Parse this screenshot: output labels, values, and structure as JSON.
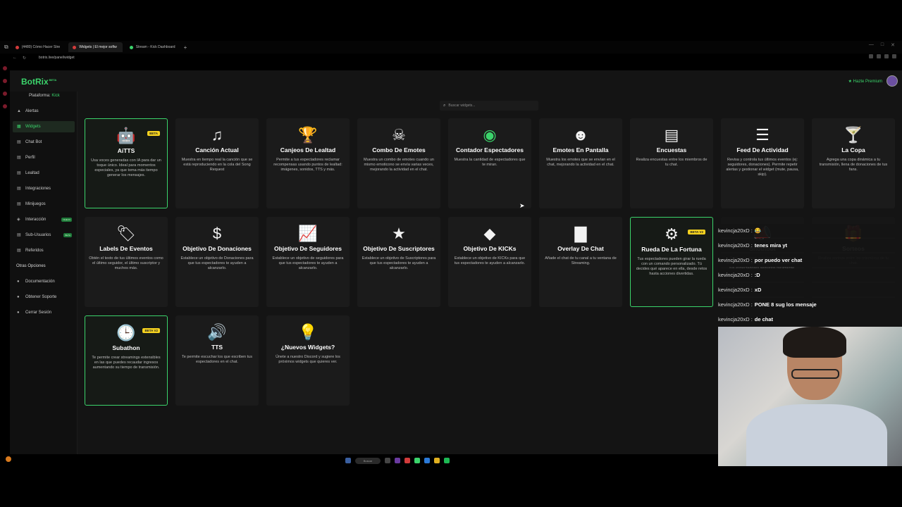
{
  "browser": {
    "tabs": [
      {
        "label": "(4480) Cómo Hacer Stre",
        "color": "#d23b3b",
        "active": false
      },
      {
        "label": "Widgets | El mejor softw",
        "color": "#d23b3b",
        "active": true
      },
      {
        "label": "Stream - Kick Dashboard",
        "color": "#3bd46b",
        "active": false
      }
    ],
    "url": "botrix.live/panel/widget"
  },
  "app": {
    "logo": "BotRix",
    "logo_badge": "BETA",
    "premium": "★ Hazte Premium",
    "platform_label": "Plataforma:",
    "platform_value": "Kick"
  },
  "sidebar": {
    "items": [
      {
        "label": "Alertas",
        "icon": "▲"
      },
      {
        "label": "Widgets",
        "icon": "▦"
      },
      {
        "label": "Chat Bot",
        "icon": "▤"
      },
      {
        "label": "Perfil",
        "icon": "▤"
      },
      {
        "label": "Lealtad",
        "icon": "▤"
      },
      {
        "label": "Integraciones",
        "icon": "▤"
      },
      {
        "label": "Minijuegos",
        "icon": "▤"
      },
      {
        "label": "Interacción",
        "icon": "◈",
        "badge": "NUEVO"
      },
      {
        "label": "Sub-Usuarios",
        "icon": "▤",
        "badge": "BETA"
      },
      {
        "label": "Referidos",
        "icon": "▤"
      }
    ],
    "other_title": "Otras Opciones",
    "other_items": [
      {
        "label": "Documentación",
        "icon": "●"
      },
      {
        "label": "Obtener Soporte",
        "icon": "●"
      },
      {
        "label": "Cerrar Sesión",
        "icon": "●"
      }
    ]
  },
  "search": {
    "placeholder": "Buscar widgets..."
  },
  "widgets": [
    {
      "title": "AiTTS",
      "desc": "Usa voces generadas con IA para dar un toque único. Ideal para momentos especiales, ya que toma más tiempo generar los mensajes.",
      "icon": "robot-icon",
      "glyph": "🤖",
      "badge": "BETA",
      "highlight": true
    },
    {
      "title": "Canción Actual",
      "desc": "Muestra en tiempo real la canción que se está reproduciendo en la cola del Song Request",
      "icon": "music-icon",
      "glyph": "♫"
    },
    {
      "title": "Canjeos De Lealtad",
      "desc": "Permite a tus espectadores reclamar recompensas usando puntos de lealtad: imágenes, sonidos, TTS y más.",
      "icon": "trophy-icon",
      "glyph": "🏆"
    },
    {
      "title": "Combo De Emotes",
      "desc": "Muestra un combo de emotes cuando un mismo emoticono se envía varias veces, mejorando la actividad en el chat.",
      "icon": "skull-icon",
      "glyph": "☠"
    },
    {
      "title": "Contador Espectadores",
      "desc": "Muestra la cantidad de espectadores que te miran.",
      "icon": "eye-icon",
      "glyph": "◉",
      "icon_color": "#3bd46b"
    },
    {
      "title": "Emotes En Pantalla",
      "desc": "Muestra los emotes que se envían en el chat, mejorando la actividad en el chat.",
      "icon": "grin-icon",
      "glyph": "☻"
    },
    {
      "title": "Encuestas",
      "desc": "Realiza encuestas entre los miembros de tu chat.",
      "icon": "poll-icon",
      "glyph": "▤"
    },
    {
      "title": "Feed De Actividad",
      "desc": "Revisa y controla tus últimos eventos (ej: seguidores, donaciones). Permite repetir alertas y gestionar el widget (mute, pausa, skip).",
      "icon": "list-icon",
      "glyph": "☰"
    },
    {
      "title": "La Copa",
      "desc": "Agrega una copa dinámica a tu transmisión, llena de donaciones de tus fans.",
      "icon": "cup-icon",
      "glyph": "🍸"
    },
    {
      "title": "Labels De Eventos",
      "desc": "Obtén el texto de tus últimos eventos como el último seguidor, el último suscriptor y muchos más.",
      "icon": "tag-icon",
      "glyph": "🏷"
    },
    {
      "title": "Objetivo De Donaciones",
      "desc": "Establece un objetivo de Donaciones para que tus espectadores te ayuden a alcanzarlo.",
      "icon": "dollar-icon",
      "glyph": "$"
    },
    {
      "title": "Objetivo De Seguidores",
      "desc": "Establece un objetivo de seguidores para que tus espectadores te ayuden a alcanzarlo.",
      "icon": "chart-icon",
      "glyph": "📈"
    },
    {
      "title": "Objetivo De Suscriptores",
      "desc": "Establece un objetivo de Suscriptores para que tus espectadores te ayuden a alcanzarlo.",
      "icon": "star-icon",
      "glyph": "★"
    },
    {
      "title": "Objetivo De KICKs",
      "desc": "Establece un objetivo de KICKs para que tus espectadores te ayuden a alcanzarlo.",
      "icon": "diamond-icon",
      "glyph": "◆"
    },
    {
      "title": "Overlay De Chat",
      "desc": "Añade el chat de tu canal a tu ventana de Streaming.",
      "icon": "chat-bubble-icon",
      "glyph": "▇"
    },
    {
      "title": "Rueda De La Fortuna",
      "desc": "Tus espectadores pueden girar la rueda con un comando personalizado. Tú decides qué aparece en ella, desde retos hasta acciones divertidas.",
      "icon": "wheel-icon",
      "glyph": "⚙",
      "badge": "BETA V2",
      "highlight": true
    },
    {
      "title": "Shoutout",
      "desc": "Destaca a otros creadores en tu canal mostrando su información y permitiendo a tus espectadores seguirlos fácilmente.",
      "icon": "megaphone-icon",
      "glyph": "📣",
      "hidden_under_chat": true
    },
    {
      "title": "Sorteos",
      "desc": "Realiza sorteos entre los miembros de tu chat.",
      "icon": "gift-icon",
      "glyph": "🎁",
      "hidden_under_chat": true
    },
    {
      "title": "Subathon",
      "desc": "Te permite crear streamings extensibles en las que puedes recaudar ingresos aumentando su tiempo de transmisión.",
      "icon": "clock-icon",
      "glyph": "🕒",
      "badge": "BETA V2",
      "highlight": true
    },
    {
      "title": "TTS",
      "desc": "Te permite escuchar los que escriben tus espectadores en el chat.",
      "icon": "speaker-icon",
      "glyph": "🔊"
    },
    {
      "title": "¿Nuevos Widgets?",
      "desc": "Únete a nuestro Discord y sugiere los próximos widgets que quieres ver.",
      "icon": "lightbulb-icon",
      "glyph": "💡"
    }
  ],
  "chat": [
    {
      "user": "kevincja20xD :",
      "text": "😂"
    },
    {
      "user": "kevincja20xD :",
      "text": "tenes mira yt"
    },
    {
      "user": "kevincja20xD :",
      "text": "por puedo ver chat"
    },
    {
      "user": "kevincja20xD :",
      "text": ":D"
    },
    {
      "user": "kevincja20xD :",
      "text": "xD"
    },
    {
      "user": "kevincja20xD :",
      "text": "PONE 8 sug los mensaje"
    },
    {
      "user": "kevincja20xD :",
      "text": "de chat"
    }
  ],
  "taskbar": {
    "search": "Buscar"
  }
}
